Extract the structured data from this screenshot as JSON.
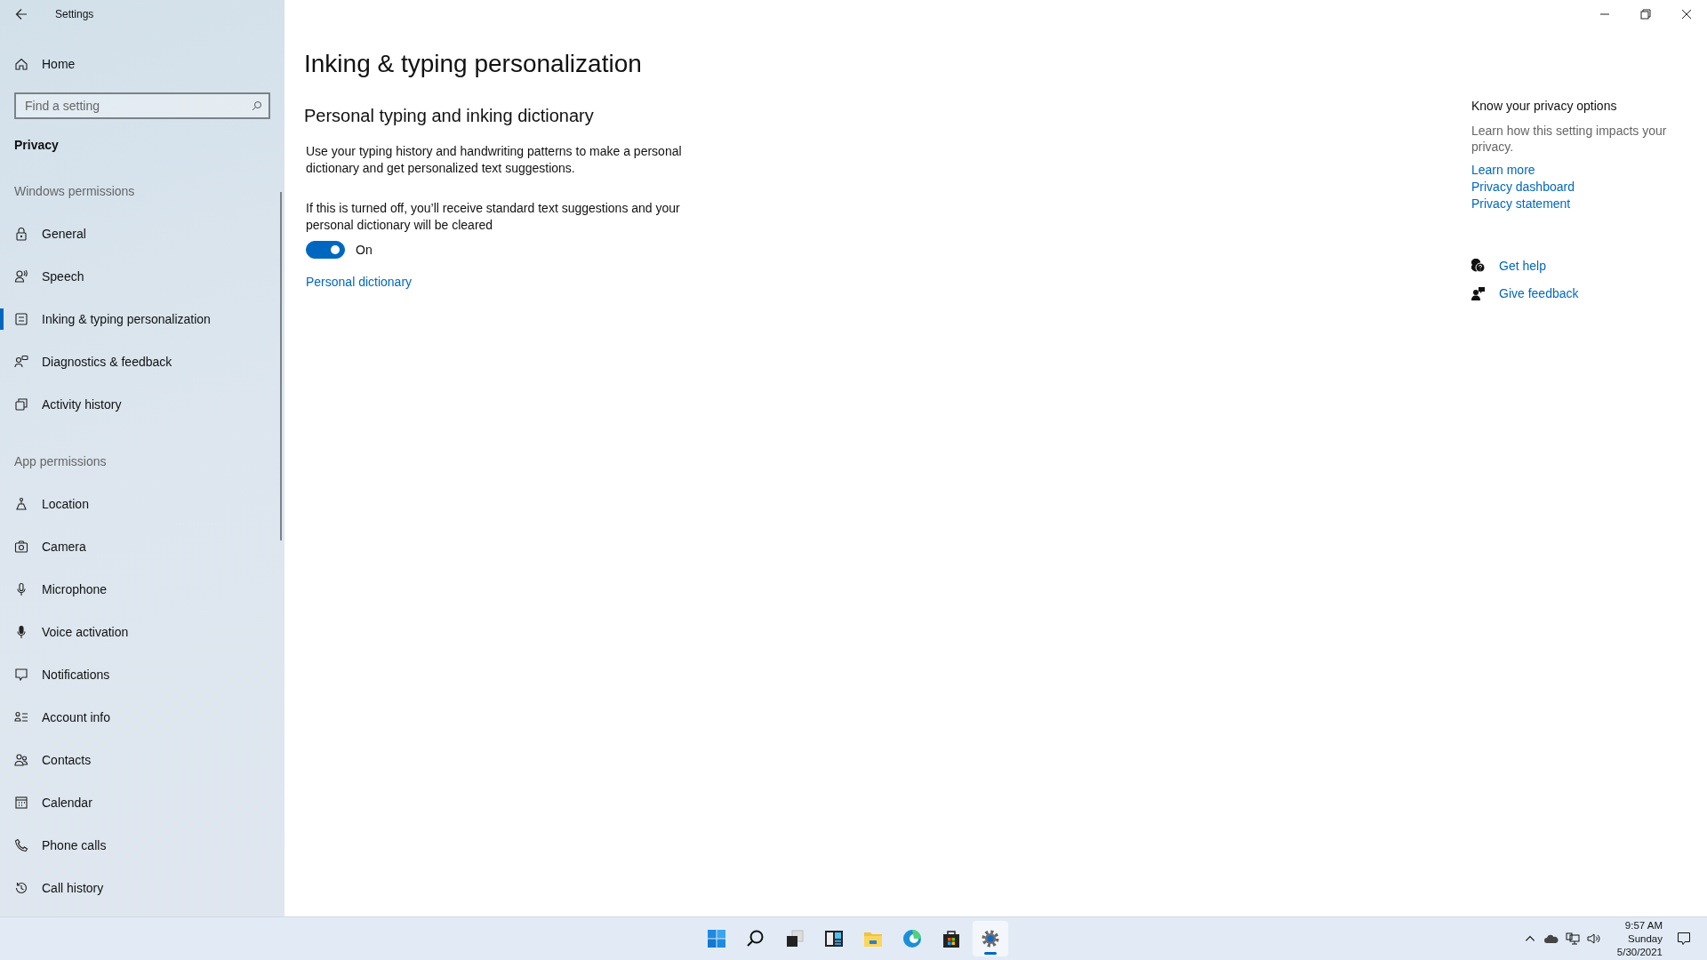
{
  "window": {
    "title": "Settings"
  },
  "sidebar": {
    "home": "Home",
    "search": {
      "placeholder": "Find a setting"
    },
    "section": "Privacy",
    "groups": [
      {
        "heading": "Windows permissions",
        "items": [
          {
            "label": "General",
            "selected": false
          },
          {
            "label": "Speech",
            "selected": false
          },
          {
            "label": "Inking & typing personalization",
            "selected": true
          },
          {
            "label": "Diagnostics & feedback",
            "selected": false
          },
          {
            "label": "Activity history",
            "selected": false
          }
        ]
      },
      {
        "heading": "App permissions",
        "items": [
          {
            "label": "Location",
            "selected": false
          },
          {
            "label": "Camera",
            "selected": false
          },
          {
            "label": "Microphone",
            "selected": false
          },
          {
            "label": "Voice activation",
            "selected": false
          },
          {
            "label": "Notifications",
            "selected": false
          },
          {
            "label": "Account info",
            "selected": false
          },
          {
            "label": "Contacts",
            "selected": false
          },
          {
            "label": "Calendar",
            "selected": false
          },
          {
            "label": "Phone calls",
            "selected": false
          },
          {
            "label": "Call history",
            "selected": false
          }
        ]
      }
    ]
  },
  "main": {
    "title": "Inking & typing personalization",
    "subtitle": "Personal typing and inking dictionary",
    "description": "Use your typing history and handwriting patterns to make a personal dictionary and get personalized text suggestions.",
    "note": "If this is turned off, you’ll receive standard text suggestions and your personal dictionary will be cleared",
    "toggle": {
      "on": true,
      "label": "On"
    },
    "link": "Personal dictionary"
  },
  "aside": {
    "heading": "Know your privacy options",
    "text": "Learn how this setting impacts your privacy.",
    "links": [
      "Learn more",
      "Privacy dashboard",
      "Privacy statement"
    ],
    "support": [
      "Get help",
      "Give feedback"
    ]
  },
  "taskbar": {
    "apps": [
      {
        "selected": false
      },
      {
        "selected": false
      },
      {
        "selected": false
      },
      {
        "selected": false
      },
      {
        "selected": false
      },
      {
        "selected": false
      },
      {
        "selected": false
      },
      {
        "selected": true
      }
    ],
    "time": "9:57 AM",
    "day": "Sunday",
    "date": "5/30/2021"
  }
}
